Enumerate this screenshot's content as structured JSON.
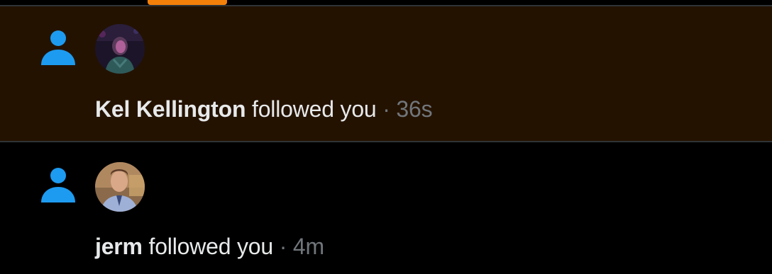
{
  "theme": {
    "accent": "#f4800a",
    "unread_background": "#241200",
    "follow_icon_color": "#1d9bf0"
  },
  "notifications": [
    {
      "type": "follow",
      "icon": "person-icon",
      "unread": true,
      "user_name": "Kel Kellington",
      "action_text": "followed you",
      "separator": "·",
      "time": "36s"
    },
    {
      "type": "follow",
      "icon": "person-icon",
      "unread": false,
      "user_name": "jerm",
      "action_text": "followed you",
      "separator": "·",
      "time": "4m"
    }
  ]
}
